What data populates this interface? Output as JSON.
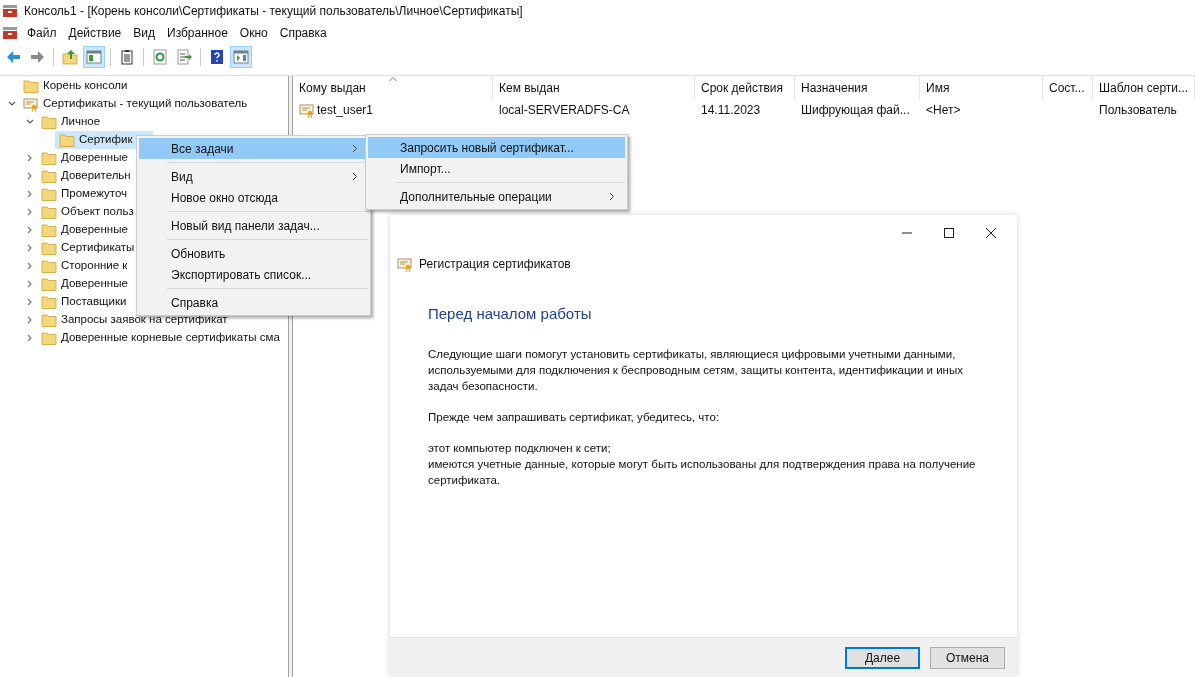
{
  "window": {
    "title": "Консоль1 - [Корень консоли\\Сертификаты - текущий пользователь\\Личное\\Сертификаты]"
  },
  "menu_bar": [
    "Файл",
    "Действие",
    "Вид",
    "Избранное",
    "Окно",
    "Справка"
  ],
  "toolbar": [
    {
      "kind": "back",
      "pressed": false
    },
    {
      "kind": "forward",
      "pressed": false
    },
    {
      "kind": "separator"
    },
    {
      "kind": "up",
      "pressed": false
    },
    {
      "kind": "tree",
      "pressed": true
    },
    {
      "kind": "separator"
    },
    {
      "kind": "properties",
      "pressed": false
    },
    {
      "kind": "separator"
    },
    {
      "kind": "refresh",
      "pressed": false
    },
    {
      "kind": "export",
      "pressed": false
    },
    {
      "kind": "separator"
    },
    {
      "kind": "help",
      "pressed": false
    },
    {
      "kind": "actions",
      "pressed": true
    }
  ],
  "tree": [
    {
      "label": "Корень консоли",
      "kind": "folder",
      "selected": false
    },
    {
      "label": "Сертификаты - текущий пользователь",
      "kind": "store",
      "selected": false,
      "expanded": true,
      "children": [
        {
          "label": "Личное",
          "kind": "folder",
          "selected": false,
          "expanded": true,
          "children": [
            {
              "label": "Сертифик",
              "kind": "folder",
              "selected": true
            }
          ]
        },
        {
          "label": "Доверенные",
          "kind": "folder",
          "selected": false,
          "expanded": false
        },
        {
          "label": "Доверительн",
          "kind": "folder",
          "selected": false,
          "expanded": false
        },
        {
          "label": "Промежуточ",
          "kind": "folder",
          "selected": false,
          "expanded": false
        },
        {
          "label": "Объект польз",
          "kind": "folder",
          "selected": false,
          "expanded": false
        },
        {
          "label": "Доверенные",
          "kind": "folder",
          "selected": false,
          "expanded": false
        },
        {
          "label": "Сертификаты",
          "kind": "folder",
          "selected": false,
          "expanded": false
        },
        {
          "label": "Сторонние к",
          "kind": "folder",
          "selected": false,
          "expanded": false
        },
        {
          "label": "Доверенные",
          "kind": "folder",
          "selected": false,
          "expanded": false
        },
        {
          "label": "Поставщики",
          "kind": "folder",
          "selected": false,
          "expanded": false
        },
        {
          "label": "Запросы заявок на сертификат",
          "kind": "folder",
          "selected": false,
          "expanded": false
        },
        {
          "label": "Доверенные корневые сертификаты сма",
          "kind": "folder",
          "selected": false,
          "expanded": false
        }
      ]
    }
  ],
  "table": {
    "columns": [
      {
        "label": "Кому выдан",
        "sorted": true
      },
      {
        "label": "Кем выдан",
        "sorted": false
      },
      {
        "label": "Срок действия",
        "sorted": false
      },
      {
        "label": "Назначения",
        "sorted": false
      },
      {
        "label": "Имя",
        "sorted": false
      },
      {
        "label": "Сост...",
        "sorted": false
      },
      {
        "label": "Шаблон серти...",
        "sorted": false
      }
    ],
    "rows": [
      {
        "cells": [
          "test_user1",
          "local-SERVERADFS-CA",
          "14.11.2023",
          "Шифрующая фай...",
          "<Нет>",
          null,
          "Пользователь"
        ]
      }
    ]
  },
  "context_menu": [
    {
      "kind": "item",
      "label": "Все задачи",
      "submenu": true,
      "selected": true
    },
    {
      "kind": "separator"
    },
    {
      "kind": "item",
      "label": "Вид",
      "submenu": true,
      "selected": false
    },
    {
      "kind": "item",
      "label": "Новое окно отсюда",
      "submenu": false,
      "selected": false
    },
    {
      "kind": "separator"
    },
    {
      "kind": "item",
      "label": "Новый вид панели задач...",
      "submenu": false,
      "selected": false
    },
    {
      "kind": "separator"
    },
    {
      "kind": "item",
      "label": "Обновить",
      "submenu": false,
      "selected": false
    },
    {
      "kind": "item",
      "label": "Экспортировать список...",
      "submenu": false,
      "selected": false
    },
    {
      "kind": "separator"
    },
    {
      "kind": "item",
      "label": "Справка",
      "submenu": false,
      "selected": false
    }
  ],
  "submenu": [
    {
      "kind": "item",
      "label": "Запросить новый сертификат...",
      "submenu": false,
      "selected": true
    },
    {
      "kind": "item",
      "label": "Импорт...",
      "submenu": false,
      "selected": false
    },
    {
      "kind": "separator"
    },
    {
      "kind": "item",
      "label": "Дополнительные операции",
      "submenu": true,
      "selected": false
    }
  ],
  "dialog": {
    "title": "Регистрация сертификатов",
    "heading": "Перед началом работы",
    "paragraphs": [
      "Следующие шаги помогут установить сертификаты, являющиеся цифровыми учетными данными, используемыми для подключения к беспроводным сетям, защиты контента, идентификации и иных задач безопасности.",
      "Прежде чем запрашивать сертификат, убедитесь, что:",
      "этот компьютер подключен к сети;\nимеются учетные данные, которые могут быть использованы для подтверждения права на получение сертификата."
    ],
    "buttons": [
      {
        "label": "Далее",
        "default": true
      },
      {
        "label": "Отмена",
        "default": false
      }
    ]
  }
}
